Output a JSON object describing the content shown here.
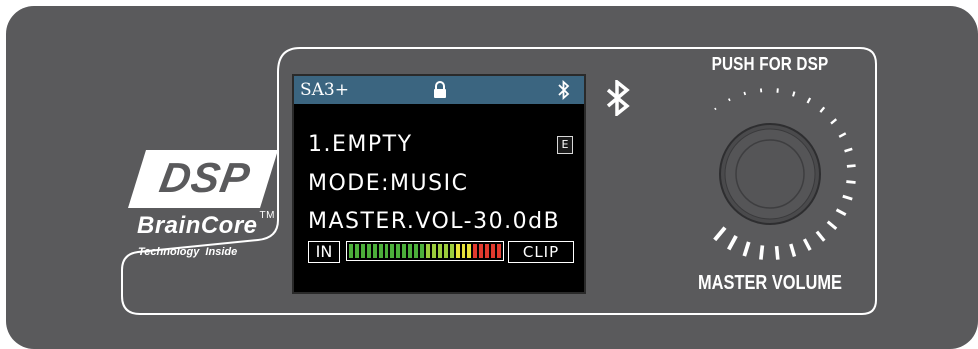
{
  "logo": {
    "badge_text": "DSP",
    "brand_name": "BrainCore",
    "trademark": "TM",
    "tagline": "Technology  Inside"
  },
  "display": {
    "model": "SA3+",
    "header_icons": [
      "lock-icon",
      "bluetooth-icon"
    ],
    "preset": "1.EMPTY",
    "preset_badge": "E",
    "mode": "MODE:MUSIC",
    "master_volume": "MASTER.VOL-30.0dB",
    "input_label": "IN",
    "clip_label": "CLIP",
    "meter_segments": 26,
    "meter_colors": {
      "green": "#4caf3a",
      "light_green": "#9ccc3c",
      "yellow": "#e8e23a",
      "red": "#e03a2e"
    },
    "header_color": "#3b6580"
  },
  "panel": {
    "bluetooth_icon": "bluetooth-icon",
    "push_label": "PUSH FOR DSP",
    "knob_label": "MASTER VOLUME",
    "panel_color": "#5a5a5c"
  }
}
